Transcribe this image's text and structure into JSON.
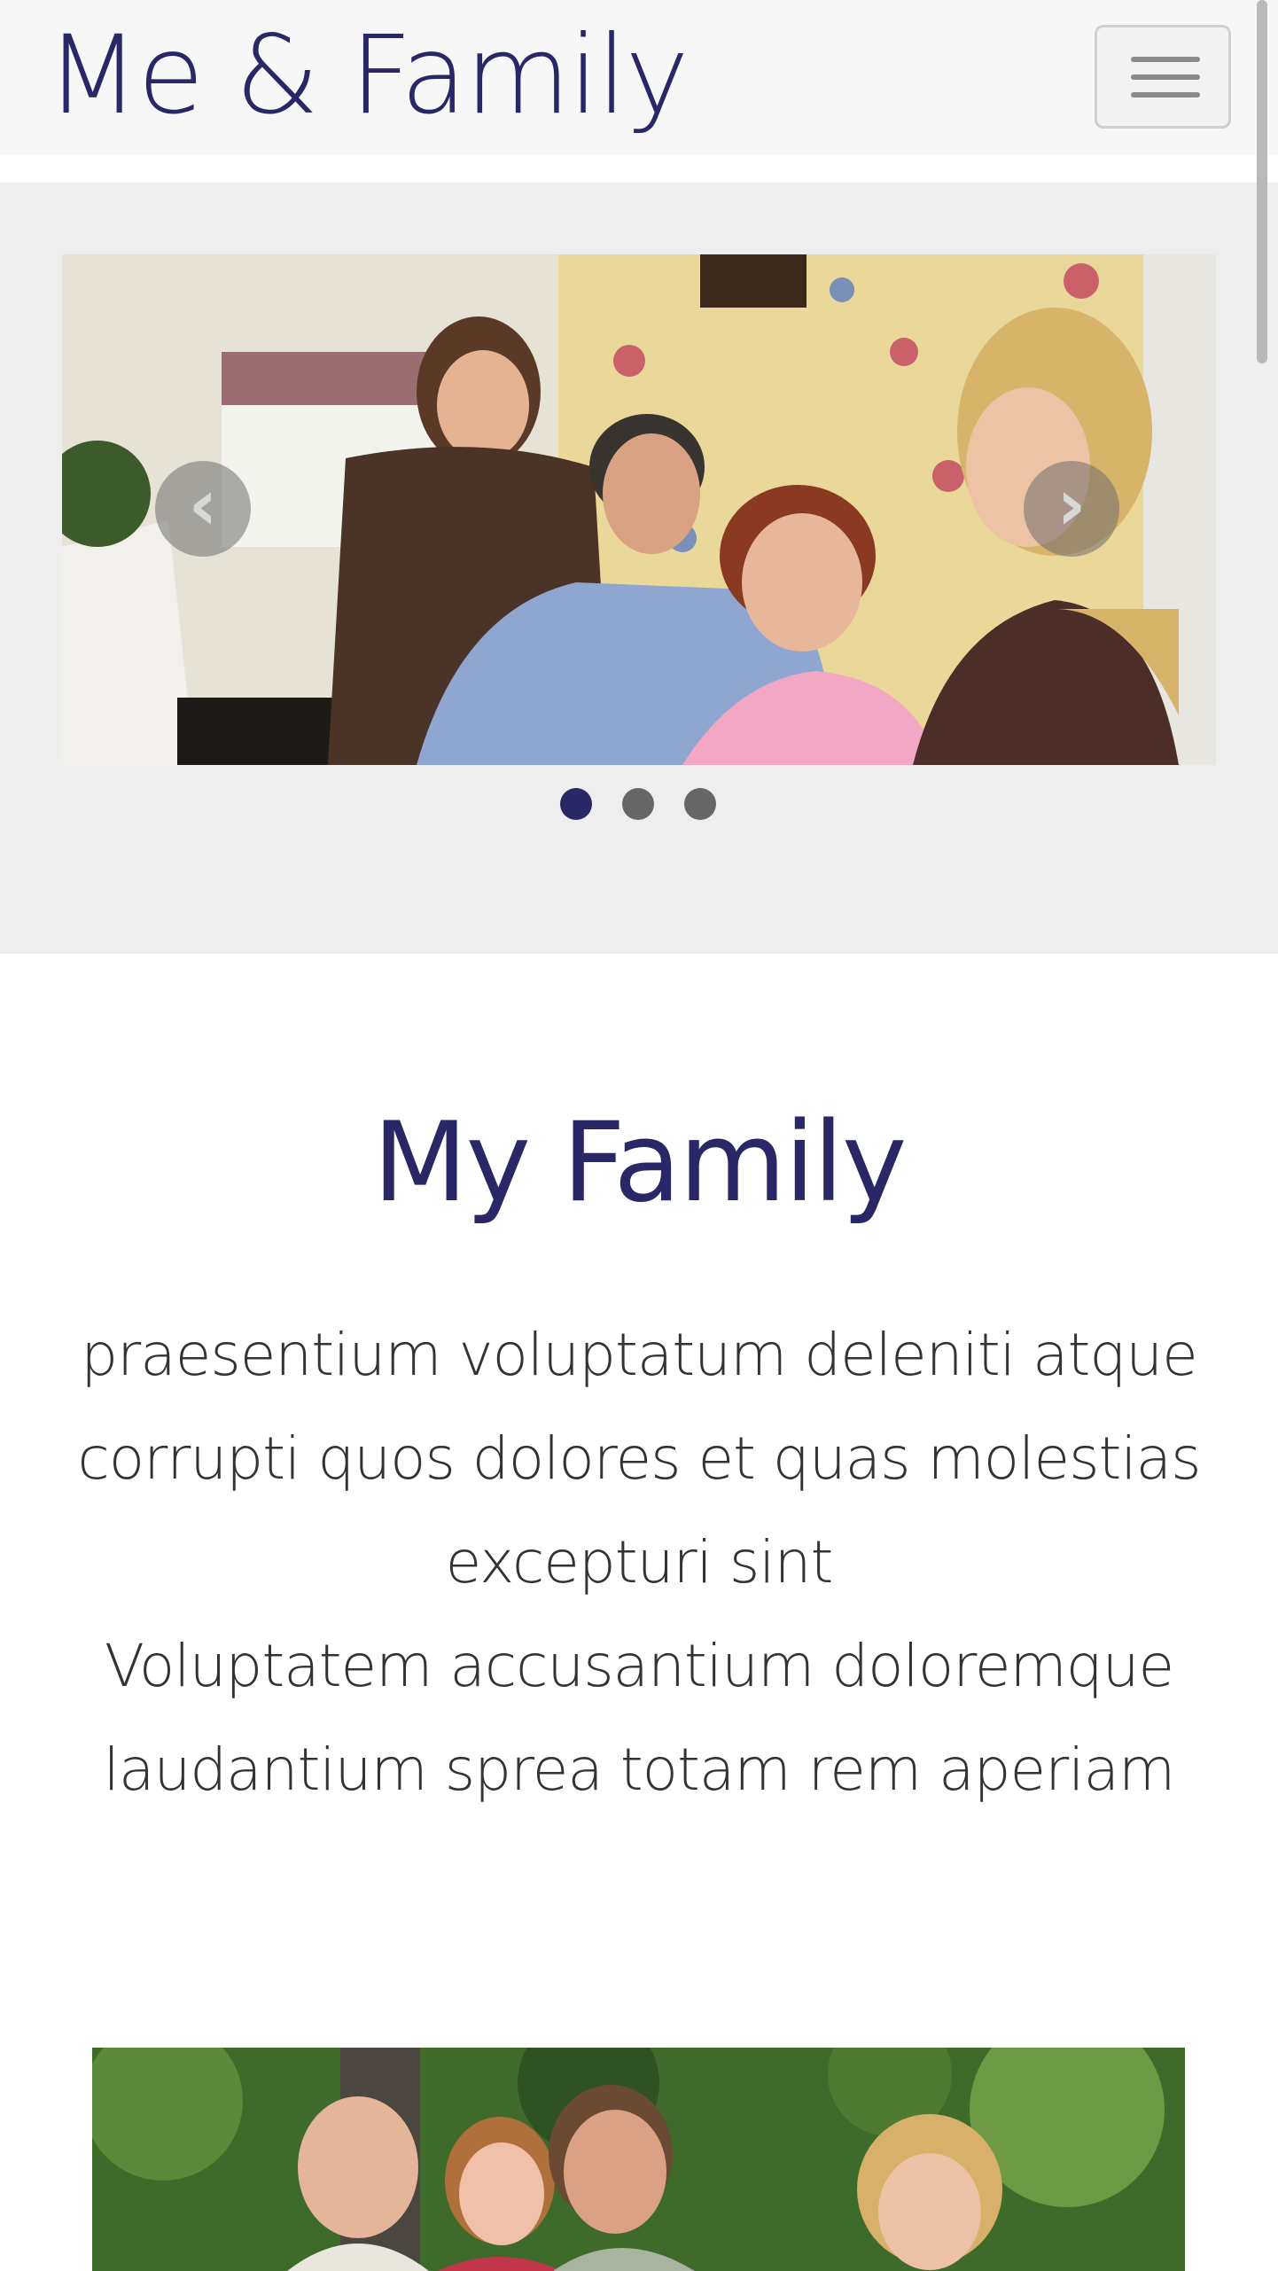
{
  "navbar": {
    "brand": "Me & Family",
    "toggle_icon": "hamburger-menu-icon"
  },
  "carousel": {
    "slide_image": "family-around-piano-photo",
    "prev_icon": "chevron-left-icon",
    "next_icon": "chevron-right-icon",
    "prev_glyph": "‹",
    "next_glyph": "›",
    "indicators": [
      {
        "active": true
      },
      {
        "active": false
      },
      {
        "active": false
      }
    ],
    "active_index": 0,
    "slide_count": 3
  },
  "section": {
    "title": "My Family",
    "paragraph1": "praesentium voluptatum deleniti atque corrupti quos dolores et quas molestias excepturi sint",
    "paragraph2": "Voluptatem accusantium doloremque laudantium sprea totam rem aperiam"
  },
  "gallery": {
    "image": "family-outdoors-photo"
  },
  "colors": {
    "brand": "#2a2766",
    "text": "#333333",
    "carousel_bg": "#eeeeee",
    "navbar_bg": "#f7f7f7",
    "indicator_inactive": "#666666"
  }
}
